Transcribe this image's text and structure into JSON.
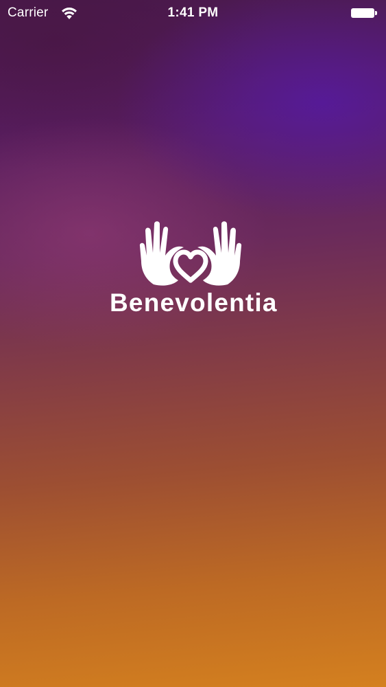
{
  "status_bar": {
    "carrier": "Carrier",
    "time": "1:41 PM",
    "icons": [
      "wifi-icon",
      "battery-icon"
    ]
  },
  "splash": {
    "app_name": "Benevolentia",
    "logo_icon": "hands-heart-icon",
    "text_color": "#ffffff"
  },
  "colors": {
    "gradient_top": "#4a1a4e",
    "gradient_purple_glow": "#561aa0",
    "gradient_bottom": "#d4801f"
  }
}
